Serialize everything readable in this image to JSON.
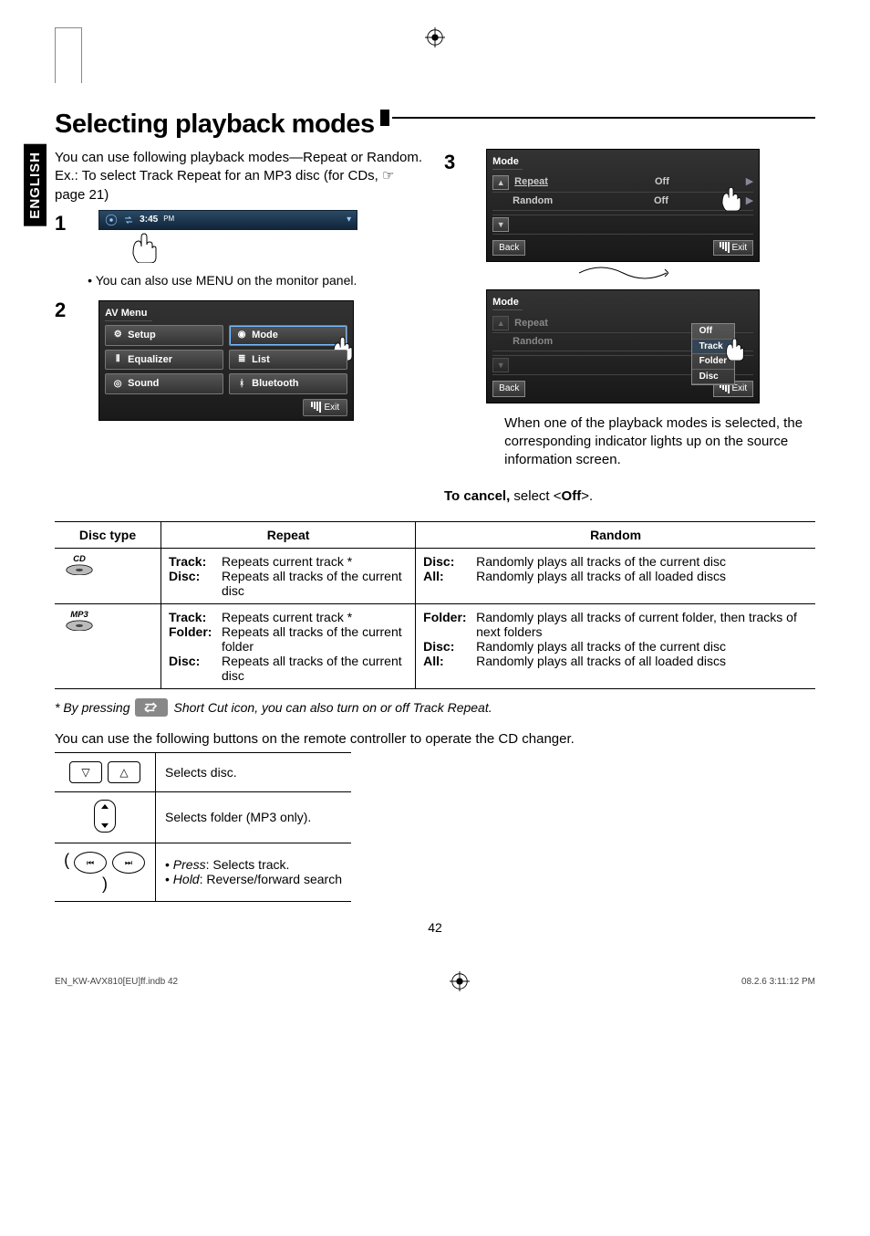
{
  "language_tab": "ENGLISH",
  "section_title": "Selecting playback modes",
  "left": {
    "intro": "You can use following playback modes—Repeat or Random.",
    "example": "Ex.: To select Track Repeat for an MP3 disc (for CDs, ☞ page 21)",
    "bullet1": "You can also use MENU on the monitor panel.",
    "disc_time": "3:45",
    "disc_ampm": "PM",
    "av_menu": {
      "title": "AV Menu",
      "items": [
        {
          "icon": "gear-icon",
          "label": "Setup"
        },
        {
          "icon": "disc-icon",
          "label": "Mode"
        },
        {
          "icon": "eq-icon",
          "label": "Equalizer"
        },
        {
          "icon": "list-icon",
          "label": "List"
        },
        {
          "icon": "speaker-icon",
          "label": "Sound"
        },
        {
          "icon": "bluetooth-icon",
          "label": "Bluetooth"
        }
      ],
      "exit": "Exit"
    }
  },
  "right": {
    "mode_title_1": "Mode",
    "panel1": {
      "rows": [
        {
          "label": "Repeat",
          "value": "Off",
          "selected": true
        },
        {
          "label": "Random",
          "value": "Off",
          "selected": false
        }
      ],
      "back": "Back",
      "exit": "Exit"
    },
    "panel2": {
      "rows": [
        {
          "label": "Repeat",
          "value": "Off",
          "selected": false
        },
        {
          "label": "Random",
          "value": "",
          "selected": false
        }
      ],
      "dropdown": [
        "Off",
        "Track",
        "Folder",
        "Disc"
      ],
      "back": "Back",
      "exit": "Exit"
    },
    "note": "When one of the playback modes is selected, the corresponding indicator lights up on the source information screen.",
    "cancel_label": "To cancel,",
    "cancel_rest": " select <Off>.",
    "cancel_bold_inner": "Off"
  },
  "table": {
    "headers": {
      "disc_type": "Disc type",
      "repeat": "Repeat",
      "random": "Random"
    },
    "rows": [
      {
        "disc_type_label": "CD",
        "repeat": [
          {
            "k": "Track:",
            "v": "Repeats current track *"
          },
          {
            "k": "Disc:",
            "v": "Repeats all tracks of the current disc"
          }
        ],
        "random": [
          {
            "k": "Disc:",
            "v": "Randomly plays all tracks of the current disc"
          },
          {
            "k": "All:",
            "v": "Randomly plays all tracks of all loaded discs"
          }
        ]
      },
      {
        "disc_type_label": "MP3",
        "repeat": [
          {
            "k": "Track:",
            "v": "Repeats current track *"
          },
          {
            "k": "Folder:",
            "v": "Repeats all tracks of the current folder"
          },
          {
            "k": "Disc:",
            "v": "Repeats all tracks of the current disc"
          }
        ],
        "random": [
          {
            "k": "Folder:",
            "v": "Randomly plays all tracks of current folder, then tracks of next folders"
          },
          {
            "k": "Disc:",
            "v": "Randomly plays all tracks of the current disc"
          },
          {
            "k": "All:",
            "v": "Randomly plays all tracks of all loaded discs"
          }
        ]
      }
    ]
  },
  "footnote_prefix": "*  By pressing",
  "footnote_suffix": "Short Cut icon, you can also turn on or off Track Repeat.",
  "remote_note": "You can use the following buttons on the remote controller to operate the CD changer.",
  "remote_rows": [
    {
      "action": "Selects disc."
    },
    {
      "action": "Selects folder (MP3 only)."
    },
    {
      "action_lines": [
        "Press: Selects track.",
        "Hold: Reverse/forward search"
      ]
    }
  ],
  "page_number": "42",
  "footer_left": "EN_KW-AVX810[EU]ff.indb   42",
  "footer_right": "08.2.6   3:11:12 PM"
}
